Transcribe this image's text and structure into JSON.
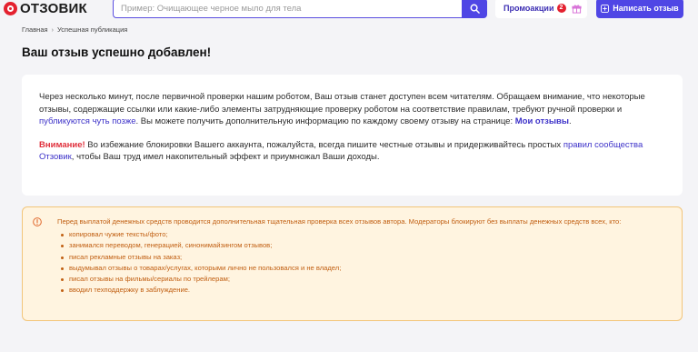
{
  "header": {
    "logo_text": "ОТЗОВИК",
    "search_placeholder": "Пример: Очищающее черное мыло для тела",
    "promo_label": "Промоакции",
    "promo_count": "2",
    "write_button_label": "Написать отзыв"
  },
  "breadcrumb": {
    "home": "Главная",
    "current": "Успешная публикация"
  },
  "page": {
    "title": "Ваш отзыв успешно добавлен!"
  },
  "info": {
    "p1_text_a": "Через несколько минут, после первичной проверки нашим роботом, Ваш отзыв станет доступен всем читателям. Обращаем внимание, что некоторые отзывы, содержащие ссылки или какие-либо элементы затрудняющие проверку роботом на соответствие правилам, требуют ручной проверки и ",
    "p1_link_later": "публикуются чуть позже",
    "p1_text_b": ". Вы можете получить дополнительную информацию по каждому своему отзыву на странице: ",
    "p1_link_my_reviews": "Мои отзывы",
    "p1_text_c": ".",
    "p2_warning": "Внимание!",
    "p2_text_a": " Во избежание блокировки Вашего аккаунта, пожалуйста, всегда пишите честные отзывы и придерживайтесь простых ",
    "p2_link_rules": "правил сообщества Отзовик",
    "p2_text_b": ", чтобы Ваш труд имел накопительный эффект и приумножал Ваши доходы."
  },
  "alert": {
    "intro": "Перед выплатой денежных средств проводится дополнительная тщательная проверка всех отзывов автора. Модераторы блокируют без выплаты денежных средств всех, кто:",
    "items": [
      "копировал чужие тексты/фото;",
      "занимался переводом, генерацией, синонимайзингом отзывов;",
      "писал рекламные отзывы на заказ;",
      "выдумывал отзывы о товарах/услугах, которыми лично не пользовался и не владел;",
      "писал отзывы на фильмы/сериалы по трейлерам;",
      "вводил техподдержку в заблуждение."
    ]
  },
  "colors": {
    "brand_red": "#e4212f",
    "accent_purple": "#4f46e5",
    "alert_text": "#c15f12",
    "alert_bg": "#fff4e0"
  }
}
